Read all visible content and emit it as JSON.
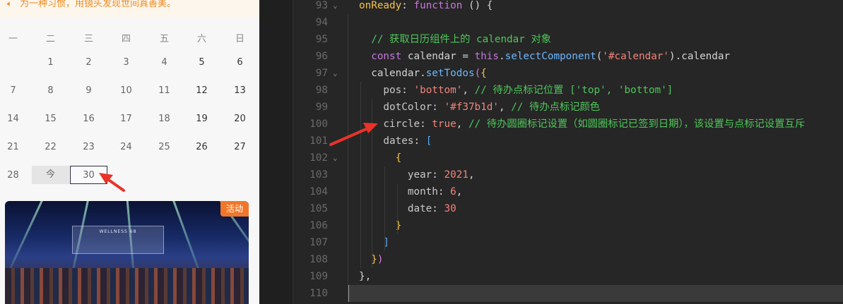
{
  "notice": {
    "text": "为一种习惯，用镜头发现世间真善美。",
    "icon": "speaker-icon"
  },
  "calendar": {
    "weekdays": [
      "一",
      "二",
      "三",
      "四",
      "五",
      "六",
      "日"
    ],
    "rows": [
      [
        "",
        "1",
        "2",
        "3",
        "4",
        "5",
        "6"
      ],
      [
        "7",
        "8",
        "9",
        "10",
        "11",
        "12",
        "13"
      ],
      [
        "14",
        "15",
        "16",
        "17",
        "18",
        "19",
        "20"
      ],
      [
        "21",
        "22",
        "23",
        "24",
        "25",
        "26",
        "27"
      ],
      [
        "28",
        "今",
        "30",
        "",
        "",
        "",
        ""
      ]
    ],
    "today_label": "今",
    "selected_day": "30"
  },
  "event_card": {
    "badge": "活动",
    "stage_text": "WELLNESS 68"
  },
  "editor": {
    "lines": [
      {
        "n": "93",
        "fold": true,
        "tokens": [
          [
            "c-key",
            "onReady"
          ],
          [
            "c-punc",
            ": "
          ],
          [
            "c-kw",
            "function"
          ],
          [
            "c-punc",
            " () {"
          ]
        ]
      },
      {
        "n": "94",
        "fold": false,
        "tokens": []
      },
      {
        "n": "95",
        "fold": false,
        "tokens": [
          [
            "c-com",
            "  // 获取日历组件上的 calendar 对象"
          ]
        ]
      },
      {
        "n": "96",
        "fold": false,
        "tokens": [
          [
            "c-kw",
            "  const"
          ],
          [
            "c-punc",
            " calendar = "
          ],
          [
            "c-kw",
            "this"
          ],
          [
            "c-punc",
            "."
          ],
          [
            "c-fn",
            "selectComponent"
          ],
          [
            "c-punc",
            "("
          ],
          [
            "c-str",
            "'#calendar'"
          ],
          [
            "c-punc",
            ").calendar"
          ]
        ]
      },
      {
        "n": "97",
        "fold": true,
        "tokens": [
          [
            "c-punc",
            "  calendar."
          ],
          [
            "c-fn",
            "setTodos"
          ],
          [
            "c-br2",
            "("
          ],
          [
            "c-br1",
            "{"
          ]
        ]
      },
      {
        "n": "98",
        "fold": false,
        "tokens": [
          [
            "c-prop",
            "    pos"
          ],
          [
            "c-punc",
            ": "
          ],
          [
            "c-str",
            "'bottom'"
          ],
          [
            "c-punc",
            ", "
          ],
          [
            "c-com",
            "// 待办点标记位置 ['top', 'bottom']"
          ]
        ]
      },
      {
        "n": "99",
        "fold": false,
        "tokens": [
          [
            "c-prop",
            "    dotColor"
          ],
          [
            "c-punc",
            ": "
          ],
          [
            "c-str",
            "'#f37b1d'"
          ],
          [
            "c-punc",
            ", "
          ],
          [
            "c-com",
            "// 待办点标记颜色"
          ]
        ]
      },
      {
        "n": "100",
        "fold": false,
        "tokens": [
          [
            "c-prop",
            "    circle"
          ],
          [
            "c-punc",
            ": "
          ],
          [
            "c-num",
            "true"
          ],
          [
            "c-punc",
            ", "
          ],
          [
            "c-com",
            "// 待办圆圈标记设置（如圆圈标记已签到日期），该设置与点标记设置互斥"
          ]
        ]
      },
      {
        "n": "101",
        "fold": true,
        "tokens": [
          [
            "c-prop",
            "    dates"
          ],
          [
            "c-punc",
            ": "
          ],
          [
            "c-br3",
            "["
          ]
        ]
      },
      {
        "n": "102",
        "fold": true,
        "tokens": [
          [
            "c-br1",
            "      {"
          ]
        ]
      },
      {
        "n": "103",
        "fold": false,
        "tokens": [
          [
            "c-prop",
            "        year"
          ],
          [
            "c-punc",
            ": "
          ],
          [
            "c-num",
            "2021"
          ],
          [
            "c-punc",
            ","
          ]
        ]
      },
      {
        "n": "104",
        "fold": false,
        "tokens": [
          [
            "c-prop",
            "        month"
          ],
          [
            "c-punc",
            ": "
          ],
          [
            "c-num",
            "6"
          ],
          [
            "c-punc",
            ","
          ]
        ]
      },
      {
        "n": "105",
        "fold": false,
        "tokens": [
          [
            "c-prop",
            "        date"
          ],
          [
            "c-punc",
            ": "
          ],
          [
            "c-num",
            "30"
          ]
        ]
      },
      {
        "n": "106",
        "fold": false,
        "tokens": [
          [
            "c-br1",
            "      }"
          ]
        ]
      },
      {
        "n": "107",
        "fold": false,
        "tokens": [
          [
            "c-br3",
            "    ]"
          ]
        ]
      },
      {
        "n": "108",
        "fold": false,
        "tokens": [
          [
            "c-br1",
            "  }"
          ],
          [
            "c-br2",
            ")"
          ]
        ]
      },
      {
        "n": "109",
        "fold": false,
        "tokens": [
          [
            "c-punc",
            "},"
          ]
        ]
      },
      {
        "n": "110",
        "fold": false,
        "tokens": []
      }
    ]
  },
  "annotation_color": "#e8332a"
}
